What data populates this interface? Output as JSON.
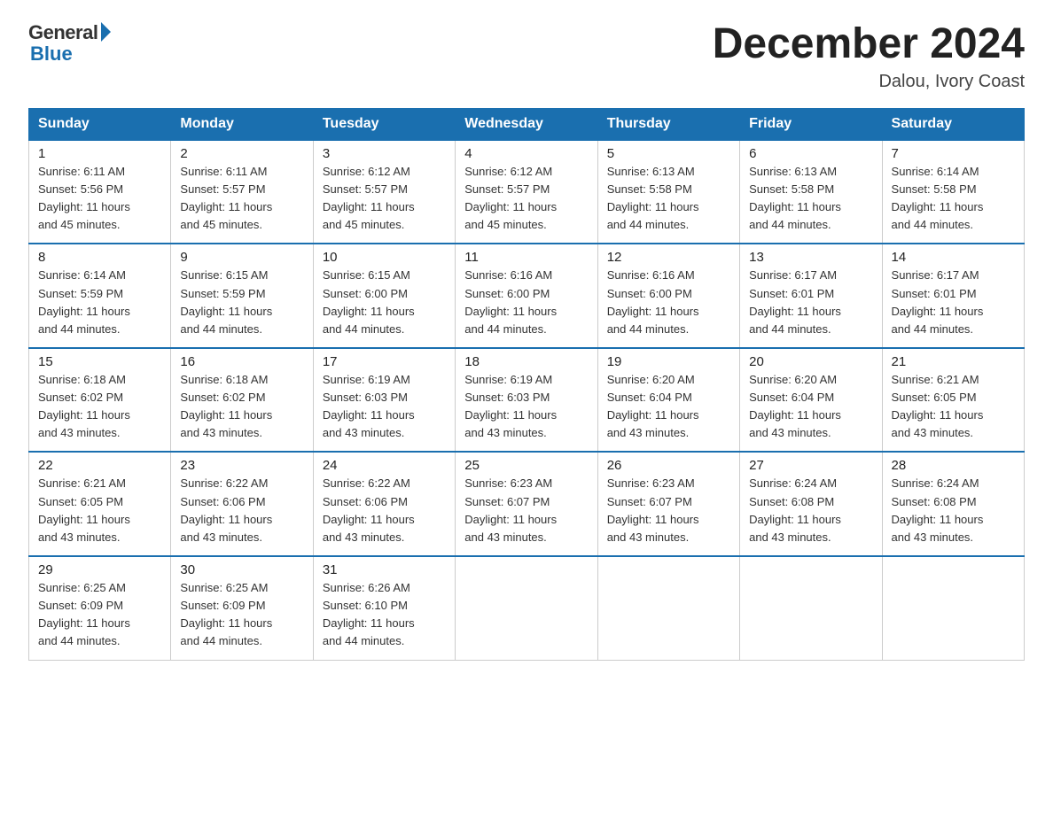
{
  "logo": {
    "general": "General",
    "blue": "Blue"
  },
  "title": "December 2024",
  "location": "Dalou, Ivory Coast",
  "days_of_week": [
    "Sunday",
    "Monday",
    "Tuesday",
    "Wednesday",
    "Thursday",
    "Friday",
    "Saturday"
  ],
  "weeks": [
    [
      {
        "day": "1",
        "sunrise": "6:11 AM",
        "sunset": "5:56 PM",
        "daylight": "11 hours and 45 minutes."
      },
      {
        "day": "2",
        "sunrise": "6:11 AM",
        "sunset": "5:57 PM",
        "daylight": "11 hours and 45 minutes."
      },
      {
        "day": "3",
        "sunrise": "6:12 AM",
        "sunset": "5:57 PM",
        "daylight": "11 hours and 45 minutes."
      },
      {
        "day": "4",
        "sunrise": "6:12 AM",
        "sunset": "5:57 PM",
        "daylight": "11 hours and 45 minutes."
      },
      {
        "day": "5",
        "sunrise": "6:13 AM",
        "sunset": "5:58 PM",
        "daylight": "11 hours and 44 minutes."
      },
      {
        "day": "6",
        "sunrise": "6:13 AM",
        "sunset": "5:58 PM",
        "daylight": "11 hours and 44 minutes."
      },
      {
        "day": "7",
        "sunrise": "6:14 AM",
        "sunset": "5:58 PM",
        "daylight": "11 hours and 44 minutes."
      }
    ],
    [
      {
        "day": "8",
        "sunrise": "6:14 AM",
        "sunset": "5:59 PM",
        "daylight": "11 hours and 44 minutes."
      },
      {
        "day": "9",
        "sunrise": "6:15 AM",
        "sunset": "5:59 PM",
        "daylight": "11 hours and 44 minutes."
      },
      {
        "day": "10",
        "sunrise": "6:15 AM",
        "sunset": "6:00 PM",
        "daylight": "11 hours and 44 minutes."
      },
      {
        "day": "11",
        "sunrise": "6:16 AM",
        "sunset": "6:00 PM",
        "daylight": "11 hours and 44 minutes."
      },
      {
        "day": "12",
        "sunrise": "6:16 AM",
        "sunset": "6:00 PM",
        "daylight": "11 hours and 44 minutes."
      },
      {
        "day": "13",
        "sunrise": "6:17 AM",
        "sunset": "6:01 PM",
        "daylight": "11 hours and 44 minutes."
      },
      {
        "day": "14",
        "sunrise": "6:17 AM",
        "sunset": "6:01 PM",
        "daylight": "11 hours and 44 minutes."
      }
    ],
    [
      {
        "day": "15",
        "sunrise": "6:18 AM",
        "sunset": "6:02 PM",
        "daylight": "11 hours and 43 minutes."
      },
      {
        "day": "16",
        "sunrise": "6:18 AM",
        "sunset": "6:02 PM",
        "daylight": "11 hours and 43 minutes."
      },
      {
        "day": "17",
        "sunrise": "6:19 AM",
        "sunset": "6:03 PM",
        "daylight": "11 hours and 43 minutes."
      },
      {
        "day": "18",
        "sunrise": "6:19 AM",
        "sunset": "6:03 PM",
        "daylight": "11 hours and 43 minutes."
      },
      {
        "day": "19",
        "sunrise": "6:20 AM",
        "sunset": "6:04 PM",
        "daylight": "11 hours and 43 minutes."
      },
      {
        "day": "20",
        "sunrise": "6:20 AM",
        "sunset": "6:04 PM",
        "daylight": "11 hours and 43 minutes."
      },
      {
        "day": "21",
        "sunrise": "6:21 AM",
        "sunset": "6:05 PM",
        "daylight": "11 hours and 43 minutes."
      }
    ],
    [
      {
        "day": "22",
        "sunrise": "6:21 AM",
        "sunset": "6:05 PM",
        "daylight": "11 hours and 43 minutes."
      },
      {
        "day": "23",
        "sunrise": "6:22 AM",
        "sunset": "6:06 PM",
        "daylight": "11 hours and 43 minutes."
      },
      {
        "day": "24",
        "sunrise": "6:22 AM",
        "sunset": "6:06 PM",
        "daylight": "11 hours and 43 minutes."
      },
      {
        "day": "25",
        "sunrise": "6:23 AM",
        "sunset": "6:07 PM",
        "daylight": "11 hours and 43 minutes."
      },
      {
        "day": "26",
        "sunrise": "6:23 AM",
        "sunset": "6:07 PM",
        "daylight": "11 hours and 43 minutes."
      },
      {
        "day": "27",
        "sunrise": "6:24 AM",
        "sunset": "6:08 PM",
        "daylight": "11 hours and 43 minutes."
      },
      {
        "day": "28",
        "sunrise": "6:24 AM",
        "sunset": "6:08 PM",
        "daylight": "11 hours and 43 minutes."
      }
    ],
    [
      {
        "day": "29",
        "sunrise": "6:25 AM",
        "sunset": "6:09 PM",
        "daylight": "11 hours and 44 minutes."
      },
      {
        "day": "30",
        "sunrise": "6:25 AM",
        "sunset": "6:09 PM",
        "daylight": "11 hours and 44 minutes."
      },
      {
        "day": "31",
        "sunrise": "6:26 AM",
        "sunset": "6:10 PM",
        "daylight": "11 hours and 44 minutes."
      },
      null,
      null,
      null,
      null
    ]
  ],
  "labels": {
    "sunrise": "Sunrise:",
    "sunset": "Sunset:",
    "daylight": "Daylight:"
  }
}
